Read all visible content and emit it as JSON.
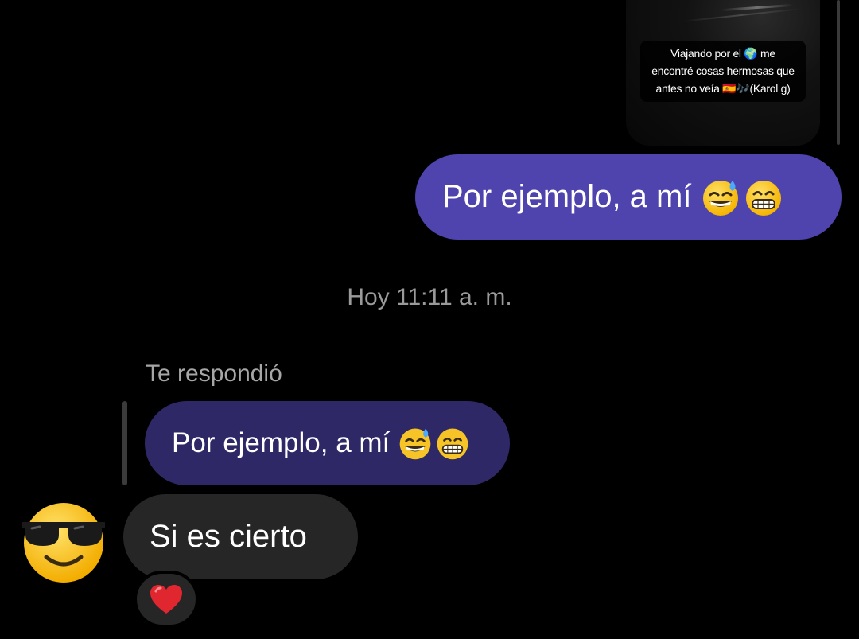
{
  "story": {
    "caption_line1": "Viajando por el 🌍 me",
    "caption_line2": "encontré cosas hermosas que",
    "caption_line3": "antes no veía 🇪🇸🎶(Karol g)"
  },
  "messages": {
    "sent_text": "Por ejemplo, a mí",
    "timestamp": "Hoy 11:11 a. m.",
    "reply_label": "Te respondió",
    "quoted_text": "Por ejemplo, a mí",
    "received_text": "Si es cierto"
  },
  "icons": {
    "sent_emojis": [
      "grinning-sweat-icon",
      "grimacing-grin-icon"
    ],
    "avatar": "sunglasses-face-icon",
    "reaction": "heart-icon"
  },
  "colors": {
    "sent_bubble": "#4f43ae",
    "quoted_bubble": "#2e2867",
    "received_bubble": "#262626",
    "background": "#000000",
    "heart": "#e0262f"
  }
}
